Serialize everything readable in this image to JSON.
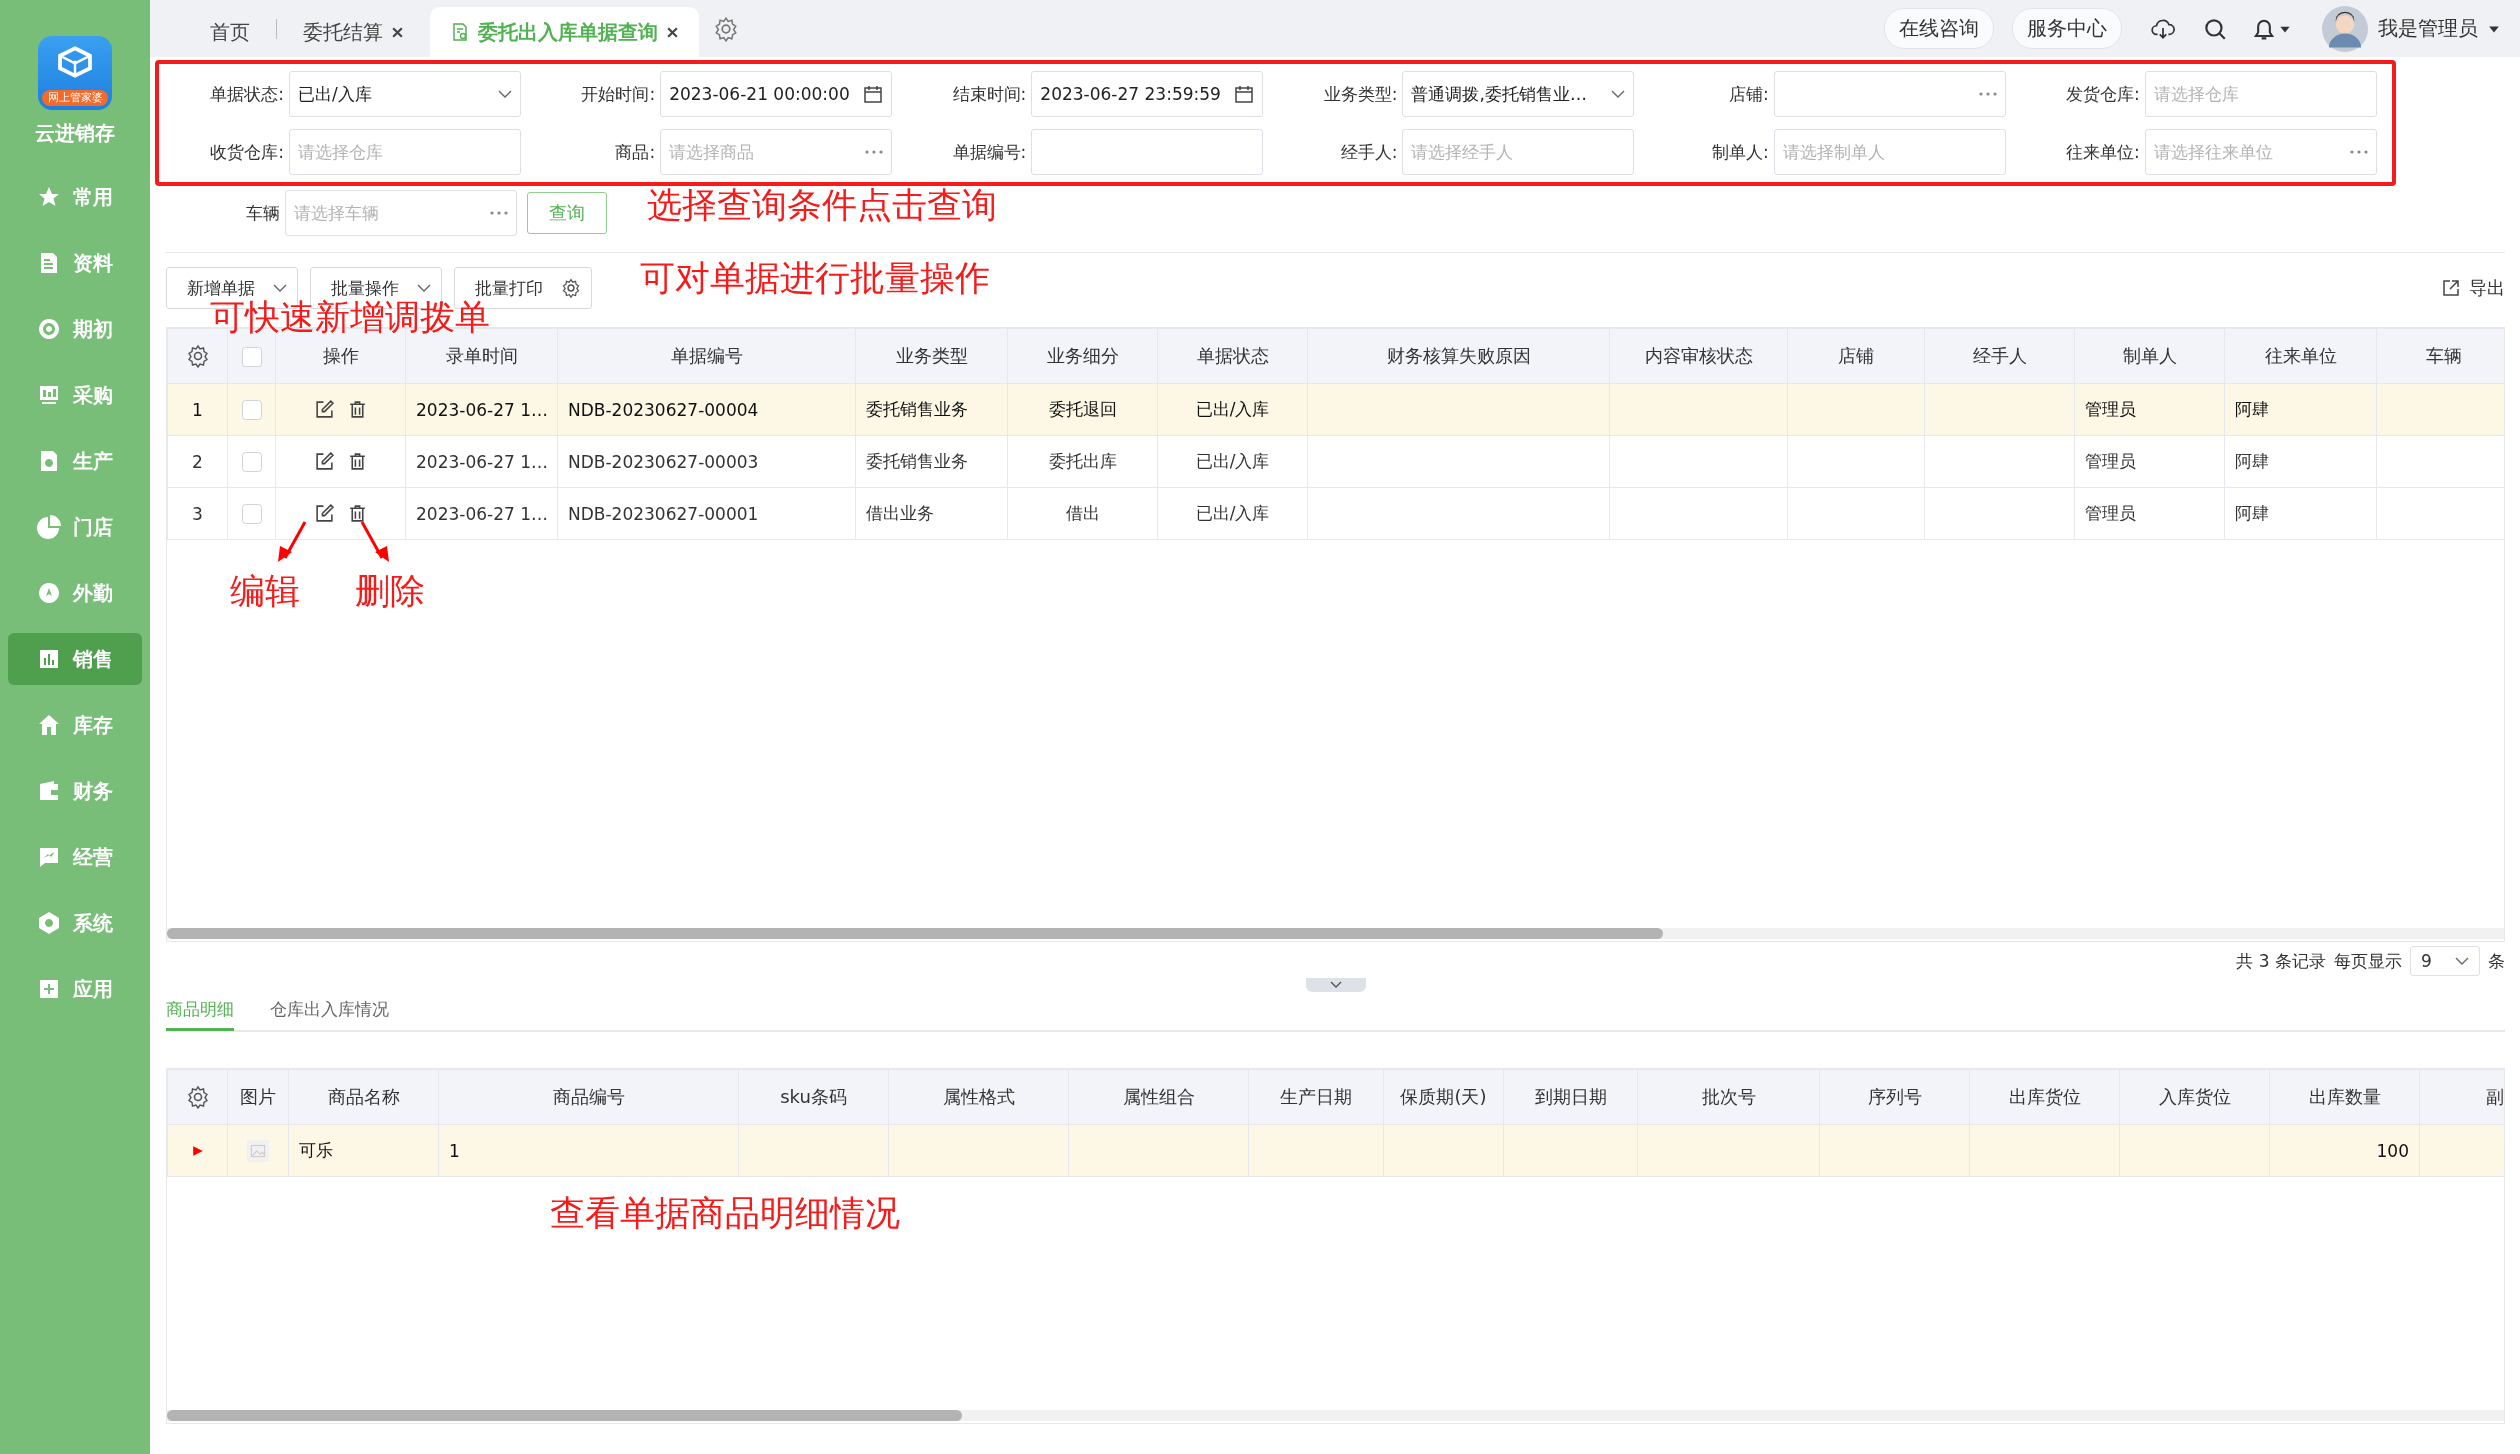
{
  "app": {
    "badge": "网上管家婆",
    "name": "云进销存"
  },
  "sidebar": {
    "items": [
      {
        "label": "常用",
        "selected": false
      },
      {
        "label": "资料",
        "selected": false
      },
      {
        "label": "期初",
        "selected": false
      },
      {
        "label": "采购",
        "selected": false
      },
      {
        "label": "生产",
        "selected": false
      },
      {
        "label": "门店",
        "selected": false
      },
      {
        "label": "外勤",
        "selected": false
      },
      {
        "label": "销售",
        "selected": true
      },
      {
        "label": "库存",
        "selected": false
      },
      {
        "label": "财务",
        "selected": false
      },
      {
        "label": "经营",
        "selected": false
      },
      {
        "label": "系统",
        "selected": false
      },
      {
        "label": "应用",
        "selected": false
      }
    ]
  },
  "tabs": [
    {
      "label": "首页",
      "selected": false,
      "closable": false
    },
    {
      "label": "委托结算",
      "selected": false,
      "closable": true
    },
    {
      "label": "委托出入库单据查询",
      "selected": true,
      "closable": true
    }
  ],
  "header_actions": [
    "在线咨询",
    "服务中心"
  ],
  "user": {
    "name": "我是管理员"
  },
  "filters": [
    {
      "label": "单据状态:",
      "kind": "select",
      "value": "已出/入库"
    },
    {
      "label": "开始时间:",
      "kind": "date",
      "value": "2023-06-21 00:00:00"
    },
    {
      "label": "结束时间:",
      "kind": "date",
      "value": "2023-06-27 23:59:59"
    },
    {
      "label": "业务类型:",
      "kind": "select",
      "value": "普通调拨,委托销售业…"
    },
    {
      "label": "店铺:",
      "kind": "picker"
    },
    {
      "label": "发货仓库:",
      "kind": "text",
      "placeholder": "请选择仓库"
    },
    {
      "label": "收货仓库:",
      "kind": "text",
      "placeholder": "请选择仓库"
    },
    {
      "label": "商品:",
      "kind": "picker",
      "placeholder": "请选择商品"
    },
    {
      "label": "单据编号:",
      "kind": "text"
    },
    {
      "label": "经手人:",
      "kind": "text",
      "placeholder": "请选择经手人"
    },
    {
      "label": "制单人:",
      "kind": "text",
      "placeholder": "请选择制单人"
    },
    {
      "label": "往来单位:",
      "kind": "picker",
      "placeholder": "请选择往来单位"
    }
  ],
  "vehicle_filter": {
    "label": "车辆",
    "kind": "picker",
    "placeholder": "请选择车辆"
  },
  "query_button": "查询",
  "annotations": [
    {
      "kind": "query",
      "text": "选择查询条件点击查询"
    },
    {
      "kind": "batch",
      "text": "可对单据进行批量操作"
    },
    {
      "kind": "new",
      "text": "可快速新增调拨单"
    },
    {
      "kind": "edit",
      "text": "编辑"
    },
    {
      "kind": "delete",
      "text": "删除"
    },
    {
      "kind": "detail",
      "text": "查看单据商品明细情况"
    }
  ],
  "toolbar": {
    "buttons": [
      {
        "label": "新增单据",
        "kind": "dropdown"
      },
      {
        "label": "批量操作",
        "kind": "dropdown"
      },
      {
        "label": "批量打印",
        "kind": "settings"
      }
    ],
    "export": "导出"
  },
  "table": {
    "columns": [
      "操作",
      "录单时间",
      "单据编号",
      "业务类型",
      "业务细分",
      "单据状态",
      "财务核算失败原因",
      "内容审核状态",
      "店铺",
      "经手人",
      "制单人",
      "往来单位",
      "车辆"
    ],
    "header_checked": false,
    "rows": [
      {
        "index": "1",
        "selected": true,
        "checked": false,
        "cells": [
          null,
          "2023-06-27 1…",
          "NDB-20230627-00004",
          "委托销售业务",
          "委托退回",
          "已出/入库",
          null,
          null,
          null,
          null,
          "管理员",
          "阿肆",
          null
        ]
      },
      {
        "index": "2",
        "selected": false,
        "checked": false,
        "cells": [
          null,
          "2023-06-27 1…",
          "NDB-20230627-00003",
          "委托销售业务",
          "委托出库",
          "已出/入库",
          null,
          null,
          null,
          null,
          "管理员",
          "阿肆",
          null
        ]
      },
      {
        "index": "3",
        "selected": false,
        "checked": false,
        "cells": [
          null,
          "2023-06-27 1…",
          "NDB-20230627-00001",
          "借出业务",
          "借出",
          "已出/入库",
          null,
          null,
          null,
          null,
          "管理员",
          "阿肆",
          null
        ]
      }
    ]
  },
  "pagination": {
    "summary": "共 3 条记录",
    "per_page_label": "每页显示",
    "per_page": "9",
    "unit": "条"
  },
  "detail_tabs": [
    {
      "label": "商品明细",
      "selected": true
    },
    {
      "label": "仓库出入库情况",
      "selected": false
    }
  ],
  "detail_table": {
    "columns": [
      "图片",
      "商品名称",
      "商品编号",
      "sku条码",
      "属性格式",
      "属性组合",
      "生产日期",
      "保质期(天)",
      "到期日期",
      "批次号",
      "序列号",
      "出库货位",
      "入库货位",
      "出库数量",
      "副"
    ],
    "rows": [
      {
        "selected": true,
        "cells": [
          null,
          "可乐",
          "1",
          null,
          null,
          null,
          null,
          null,
          null,
          null,
          null,
          null,
          null,
          "100",
          null
        ]
      }
    ]
  }
}
